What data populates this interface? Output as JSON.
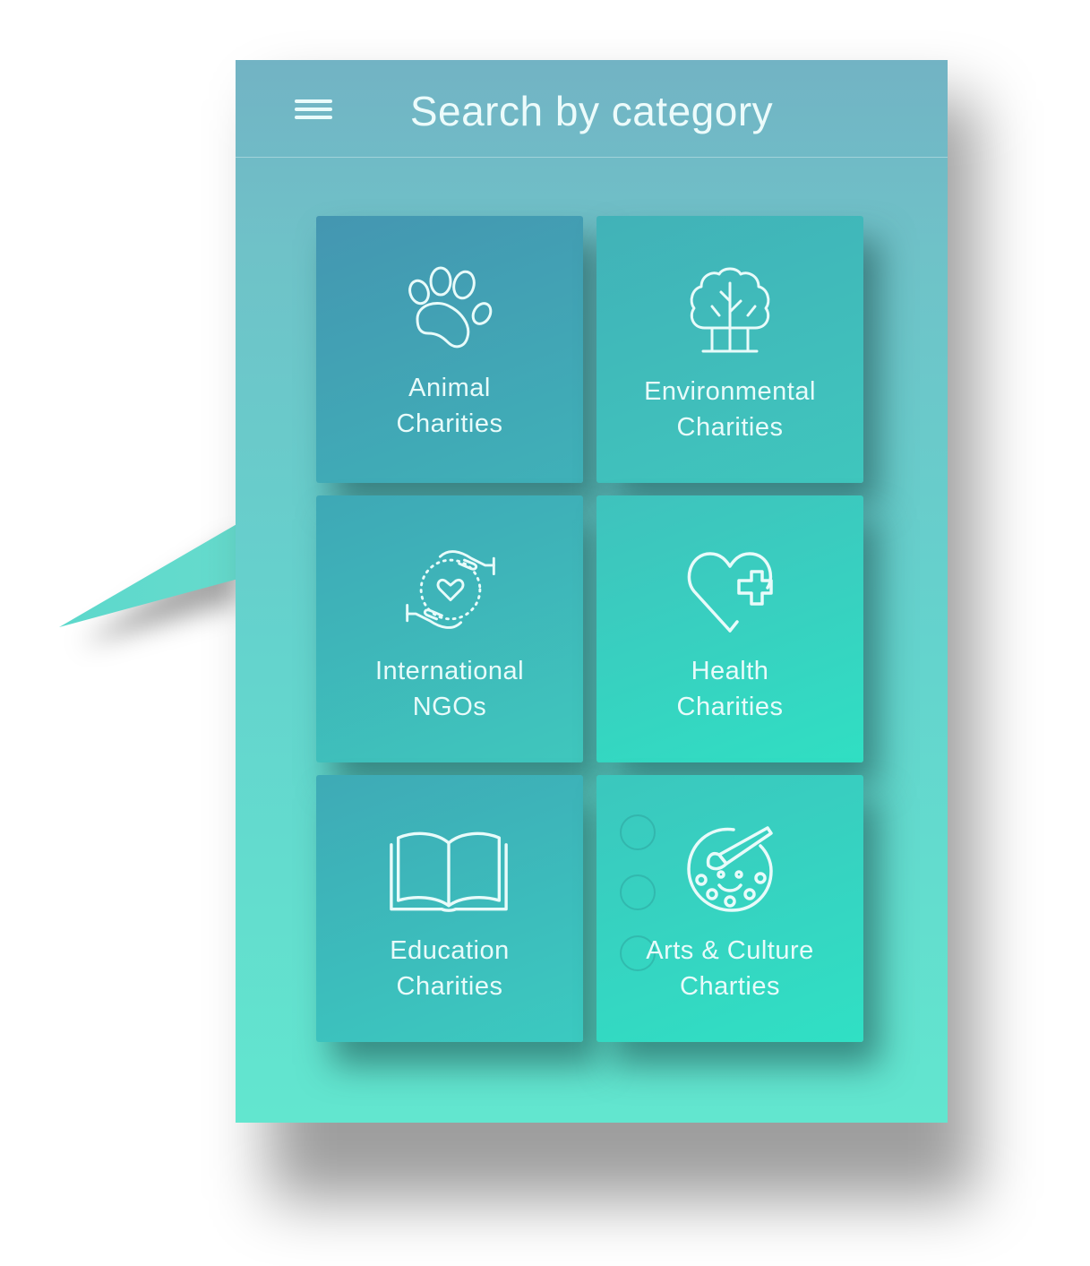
{
  "header": {
    "title": "Search by category",
    "menu_icon": "hamburger-menu-icon"
  },
  "colors": {
    "header_top": "#72b3c4",
    "background_bottom": "#62e6cf",
    "text": "#ecfbfb",
    "accent": "#30e0c4"
  },
  "categories": [
    {
      "icon": "paw-icon",
      "line1": "Animal",
      "line2": "Charities"
    },
    {
      "icon": "tree-icon",
      "line1": "Environmental",
      "line2": "Charities"
    },
    {
      "icon": "caring-hands-icon",
      "line1": "International",
      "line2": "NGOs"
    },
    {
      "icon": "heart-plus-icon",
      "line1": "Health",
      "line2": "Charities"
    },
    {
      "icon": "open-book-icon",
      "line1": "Education",
      "line2": "Charities"
    },
    {
      "icon": "paint-palette-icon",
      "line1": "Arts & Culture",
      "line2": "Charties"
    }
  ]
}
